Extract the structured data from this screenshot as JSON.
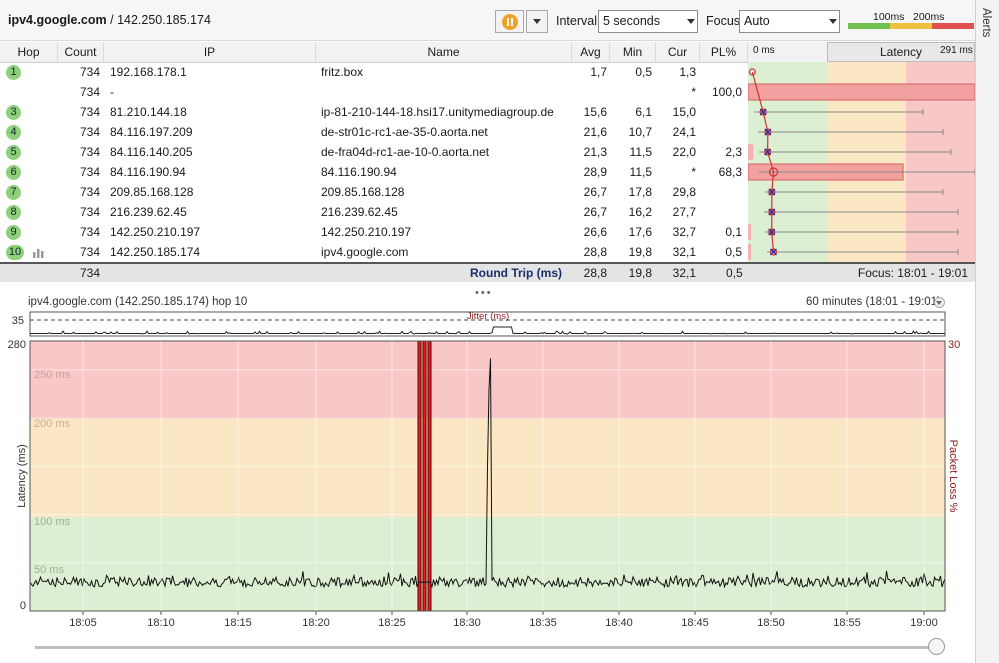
{
  "header": {
    "host": "ipv4.google.com",
    "ip_suffix": "/ 142.250.185.174",
    "interval_label": "Interval",
    "interval_value": "5 seconds",
    "focus_label": "Focus",
    "focus_value": "Auto",
    "scale_100": "100ms",
    "scale_200": "200ms",
    "colors": {
      "good": "#70c050",
      "warn": "#f0c040",
      "bad": "#e05050",
      "pause": "#f0a12a"
    }
  },
  "alerts_tab": {
    "label": "Alerts"
  },
  "table": {
    "columns": [
      "Hop",
      "Count",
      "IP",
      "Name",
      "Avg",
      "Min",
      "Cur",
      "PL%"
    ],
    "latency_header": {
      "label": "Latency",
      "min": "0 ms",
      "max": "291 ms"
    },
    "rows": [
      {
        "hop": "1",
        "count": "734",
        "ip": "192.168.178.1",
        "name": "fritz.box",
        "avg": "1,7",
        "min": "0,5",
        "cur": "1,3",
        "pl": ""
      },
      {
        "hop": "",
        "count": "734",
        "ip": "-",
        "name": "",
        "avg": "",
        "min": "",
        "cur": "*",
        "pl": "100,0"
      },
      {
        "hop": "3",
        "count": "734",
        "ip": "81.210.144.18",
        "name": "ip-81-210-144-18.hsi17.unitymediagroup.de",
        "avg": "15,6",
        "min": "6,1",
        "cur": "15,0",
        "pl": ""
      },
      {
        "hop": "4",
        "count": "734",
        "ip": "84.116.197.209",
        "name": "de-str01c-rc1-ae-35-0.aorta.net",
        "avg": "21,6",
        "min": "10,7",
        "cur": "24,1",
        "pl": ""
      },
      {
        "hop": "5",
        "count": "734",
        "ip": "84.116.140.205",
        "name": "de-fra04d-rc1-ae-10-0.aorta.net",
        "avg": "21,3",
        "min": "11,5",
        "cur": "22,0",
        "pl": "2,3"
      },
      {
        "hop": "6",
        "count": "734",
        "ip": "84.116.190.94",
        "name": "84.116.190.94",
        "avg": "28,9",
        "min": "11,5",
        "cur": "*",
        "pl": "68,3"
      },
      {
        "hop": "7",
        "count": "734",
        "ip": "209.85.168.128",
        "name": "209.85.168.128",
        "avg": "26,7",
        "min": "17,8",
        "cur": "29,8",
        "pl": ""
      },
      {
        "hop": "8",
        "count": "734",
        "ip": "216.239.62.45",
        "name": "216.239.62.45",
        "avg": "26,7",
        "min": "16,2",
        "cur": "27,7",
        "pl": ""
      },
      {
        "hop": "9",
        "count": "734",
        "ip": "142.250.210.197",
        "name": "142.250.210.197",
        "avg": "26,6",
        "min": "17,6",
        "cur": "32,7",
        "pl": "0,1"
      },
      {
        "hop": "10",
        "count": "734",
        "ip": "142.250.185.174",
        "name": "ipv4.google.com",
        "avg": "28,8",
        "min": "19,8",
        "cur": "32,1",
        "pl": "0,5"
      }
    ],
    "summary": {
      "count": "734",
      "label": "Round Trip (ms)",
      "avg": "28,8",
      "min": "19,8",
      "cur": "32,1",
      "pl": "0,5",
      "focus": "Focus: 18:01 - 19:01"
    }
  },
  "graph": {
    "title": "ipv4.google.com (142.250.185.174) hop 10",
    "range": "60 minutes (18:01 - 19:01)",
    "jitter_label": "Jitter (ms)",
    "jitter_max": "35",
    "y_max": "280",
    "y_min": "0",
    "y_label": "Latency (ms)",
    "pl_label": "Packet Loss %",
    "pl_max": "30",
    "bands": [
      "250 ms",
      "200 ms",
      "100 ms",
      "50 ms"
    ],
    "x_ticks": [
      "18:05",
      "18:10",
      "18:15",
      "18:20",
      "18:25",
      "18:30",
      "18:35",
      "18:40",
      "18:45",
      "18:50",
      "18:55",
      "19:00"
    ]
  }
}
